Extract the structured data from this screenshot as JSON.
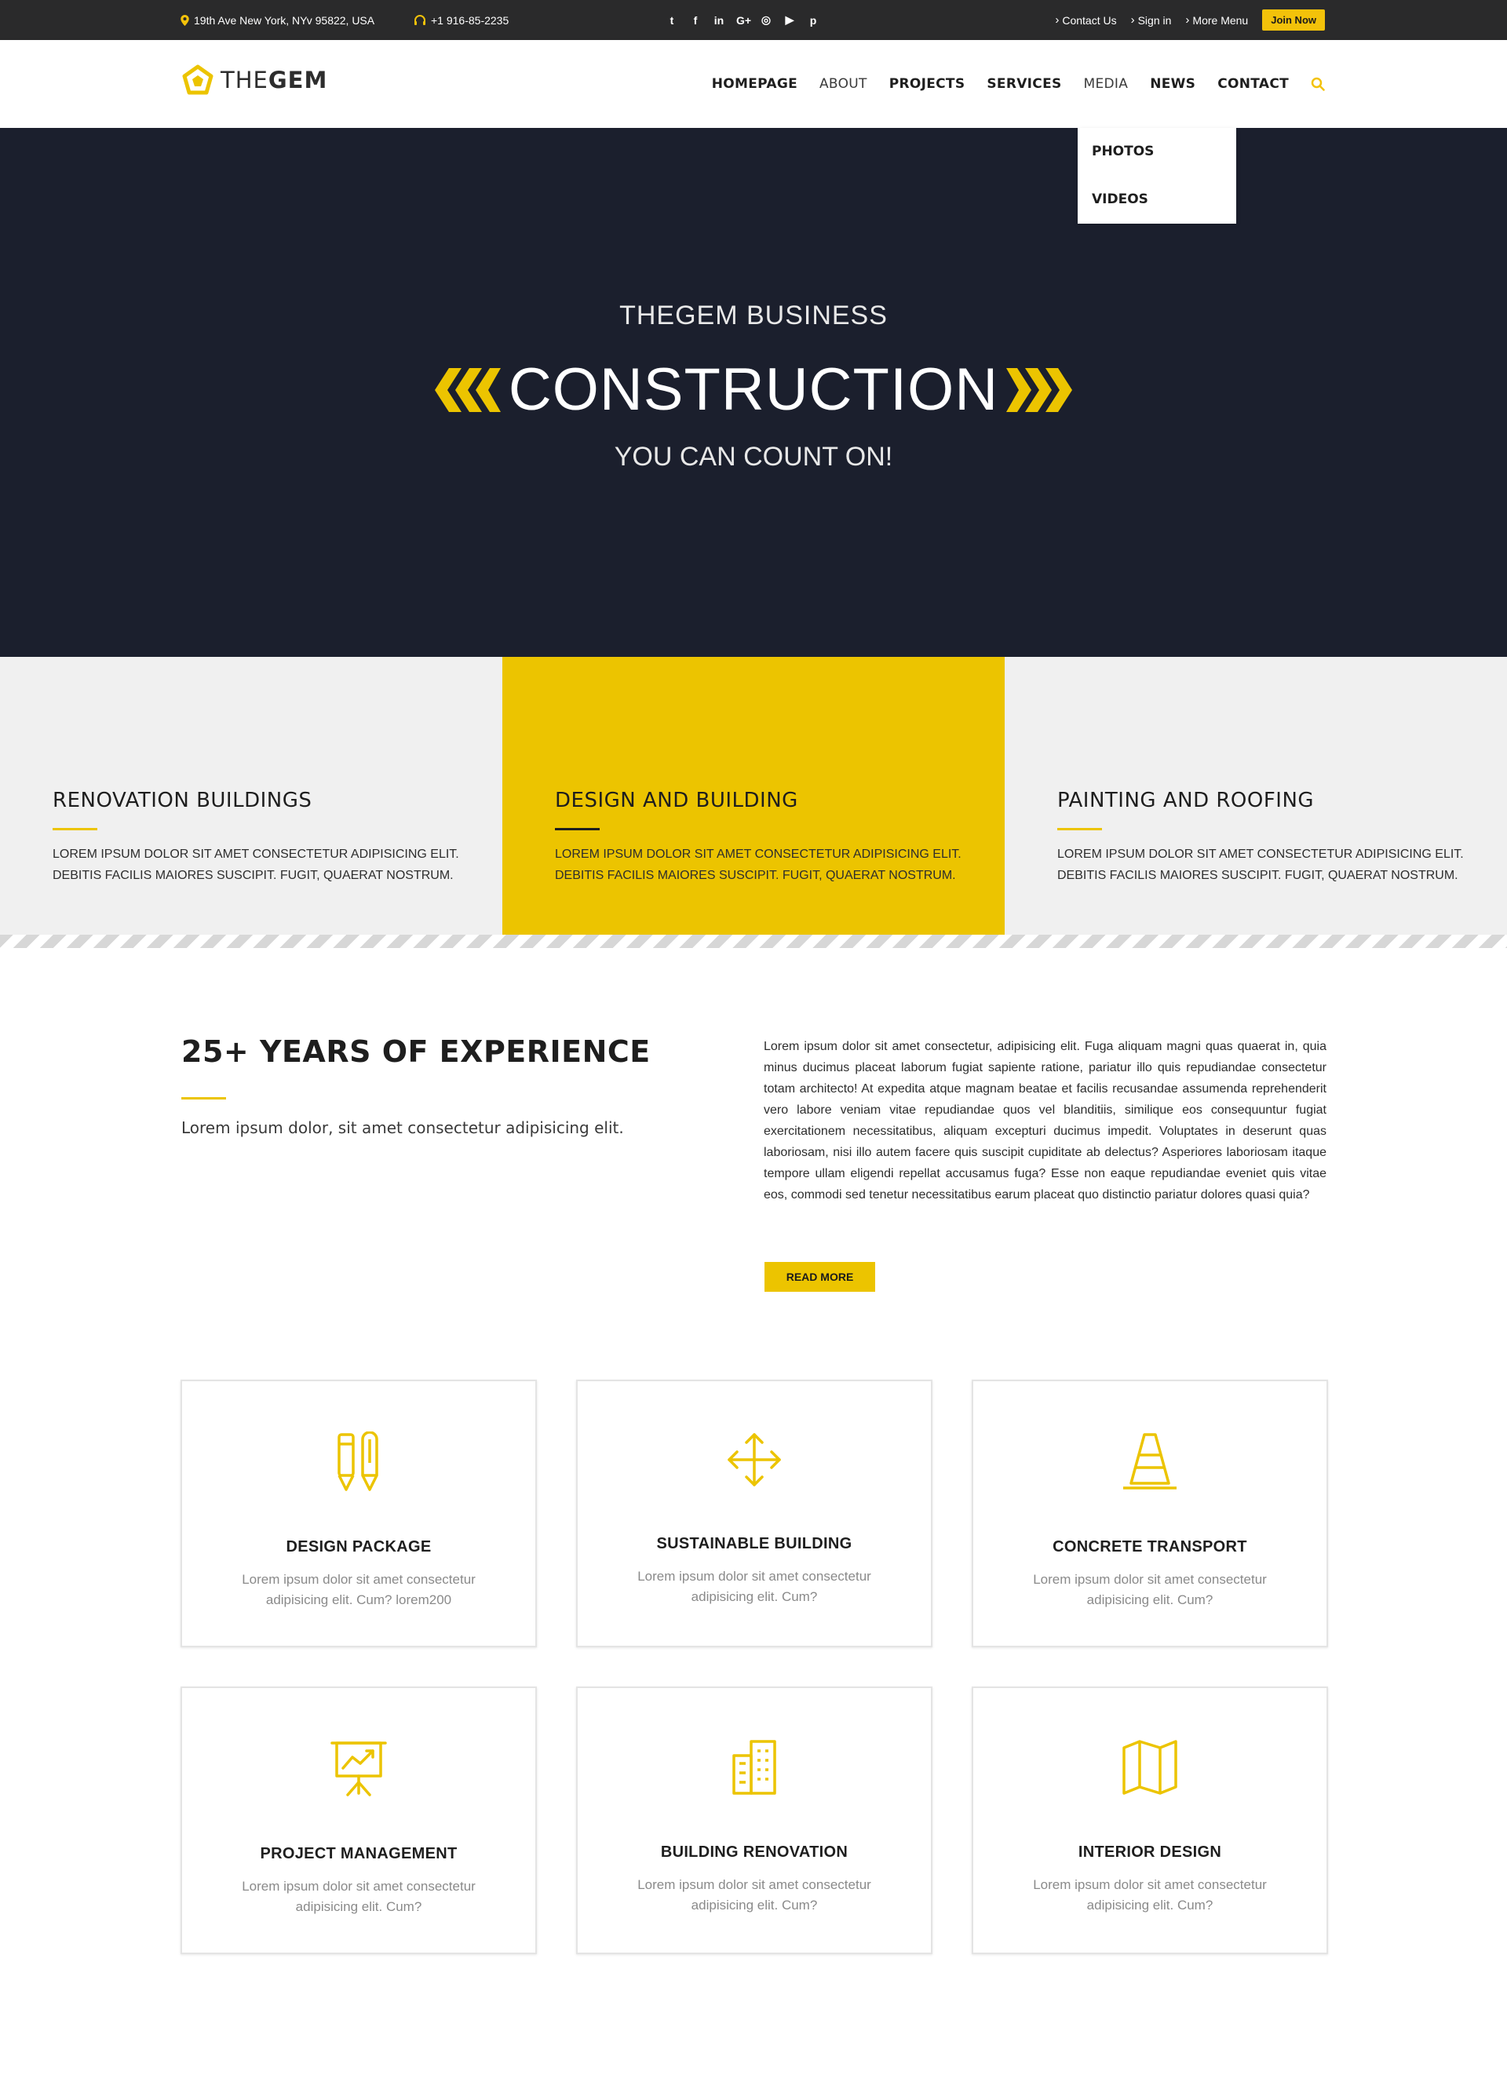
{
  "topbar": {
    "address": "19th Ave New York, NYv 95822, USA",
    "phone": "+1 916-85-2235",
    "social_icons": [
      "twitter-icon",
      "facebook-icon",
      "linkedin-icon",
      "googleplus-icon",
      "instagram-icon",
      "youtube-icon",
      "pinterest-icon"
    ],
    "links": [
      "Contact Us",
      "Sign in",
      "More Menu"
    ],
    "join_label": "Join Now"
  },
  "header": {
    "logo_light": "THE",
    "logo_bold": "GEM",
    "nav": [
      "HOMEPAGE",
      "ABOUT",
      "PROJECTS",
      "SERVICES",
      "MEDIA",
      "NEWS",
      "CONTACT"
    ],
    "dropdown": [
      "PHOTOS",
      "VIDEOS"
    ]
  },
  "hero": {
    "subtitle": "THEGEM BUSINESS",
    "title": "CONSTRUCTION",
    "tagline": "YOU CAN COUNT ON!"
  },
  "features": [
    {
      "title": "RENOVATION BUILDINGS",
      "text": "LOREM IPSUM DOLOR SIT AMET CONSECTETUR ADIPISICING ELIT. DEBITIS FACILIS MAIORES SUSCIPIT. FUGIT, QUAERAT NOSTRUM."
    },
    {
      "title": "DESIGN AND BUILDING",
      "text": "LOREM IPSUM DOLOR SIT AMET CONSECTETUR ADIPISICING ELIT. DEBITIS FACILIS MAIORES SUSCIPIT. FUGIT, QUAERAT NOSTRUM."
    },
    {
      "title": "PAINTING AND ROOFING",
      "text": "LOREM IPSUM DOLOR SIT AMET CONSECTETUR ADIPISICING ELIT. DEBITIS FACILIS MAIORES SUSCIPIT. FUGIT, QUAERAT NOSTRUM."
    }
  ],
  "experience": {
    "title": "25+ YEARS OF EXPERIENCE",
    "lead": "Lorem ipsum dolor, sit amet consectetur adipisicing elit.",
    "body": "Lorem ipsum dolor sit amet consectetur, adipisicing elit. Fuga aliquam magni quas quaerat in, quia minus ducimus placeat laborum fugiat sapiente ratione, pariatur illo quis repudiandae consectetur totam architecto! At expedita atque magnam beatae et facilis recusandae assumenda reprehenderit vero labore veniam vitae repudiandae quos vel blanditiis, similique eos consequuntur fugiat exercitationem necessitatibus, aliquam excepturi ducimus impedit. Voluptates in deserunt quas laboriosam, nisi illo autem facere quis suscipit cupiditate ab delectus? Asperiores laboriosam itaque tempore ullam eligendi repellat accusamus fuga? Esse non eaque repudiandae eveniet quis vitae eos, commodi sed tenetur necessitatibus earum placeat quo distinctio pariatur dolores quasi quia?",
    "button": "READ MORE"
  },
  "services": [
    {
      "icon": "pencils-icon",
      "title": "DESIGN PACKAGE",
      "text": "Lorem ipsum dolor sit amet consectetur adipisicing elit. Cum? lorem200"
    },
    {
      "icon": "move-arrows-icon",
      "title": "SUSTAINABLE BUILDING",
      "text": "Lorem ipsum dolor sit amet consectetur adipisicing elit. Cum?"
    },
    {
      "icon": "traffic-cone-icon",
      "title": "CONCRETE TRANSPORT",
      "text": "Lorem ipsum dolor sit amet consectetur adipisicing elit. Cum?"
    },
    {
      "icon": "presentation-chart-icon",
      "title": "PROJECT MANAGEMENT",
      "text": "Lorem ipsum dolor sit amet consectetur adipisicing elit. Cum?"
    },
    {
      "icon": "buildings-icon",
      "title": "BUILDING RENOVATION",
      "text": "Lorem ipsum dolor sit amet consectetur adipisicing elit. Cum?"
    },
    {
      "icon": "map-icon",
      "title": "INTERIOR DESIGN",
      "text": "Lorem ipsum dolor sit amet consectetur adipisicing elit. Cum?"
    }
  ],
  "colors": {
    "accent": "#ecc400",
    "dark": "#1b1f2d",
    "topbar": "#2a2a2b",
    "light": "#f0f0f0"
  }
}
